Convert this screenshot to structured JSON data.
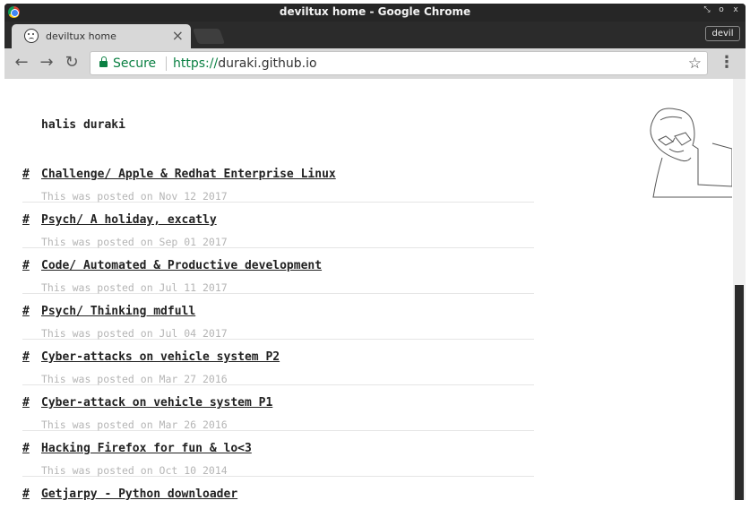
{
  "window": {
    "title": "deviltux home - Google Chrome",
    "controls": [
      "⤡",
      "o",
      "x"
    ]
  },
  "tab": {
    "title": "deviltux home",
    "close": "×"
  },
  "profile": {
    "label": "devil"
  },
  "toolbar": {
    "back": "←",
    "forward": "→",
    "reload": "↻",
    "secure_label": "Secure",
    "url_scheme": "https://",
    "url_host": "duraki.github.io",
    "star": "☆",
    "menu": "⋮"
  },
  "page": {
    "site_title": "halis duraki",
    "hash": "#",
    "posts": [
      {
        "title": "Challenge/ Apple & Redhat Enterprise Linux",
        "date": "This was posted on Nov 12 2017"
      },
      {
        "title": "Psych/ A holiday, excatly",
        "date": "This was posted on Sep 01 2017"
      },
      {
        "title": "Code/ Automated & Productive development",
        "date": "This was posted on Jul 11 2017"
      },
      {
        "title": "Psych/ Thinking mdfull",
        "date": "This was posted on Jul 04 2017"
      },
      {
        "title": "Cyber-attacks on vehicle system P2",
        "date": "This was posted on Mar 27 2016"
      },
      {
        "title": "Cyber-attack on vehicle system P1",
        "date": "This was posted on Mar 26 2016"
      },
      {
        "title": "Hacking Firefox for fun & lo<3",
        "date": "This was posted on Oct 10 2014"
      },
      {
        "title": "Getjarpy - Python downloader",
        "date": ""
      }
    ]
  },
  "colors": {
    "secure_green": "#0b8043",
    "date_gray": "#b5b5b5",
    "chrome_dark": "#2b2b2b"
  }
}
